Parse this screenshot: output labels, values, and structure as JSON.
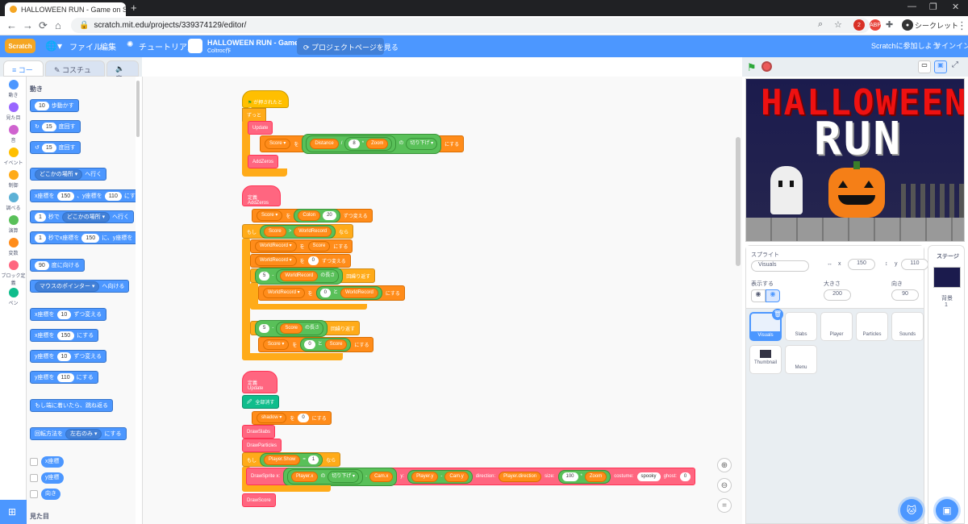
{
  "browser": {
    "tab_title": "HALLOWEEN RUN - Game on Sc",
    "url": "scratch.mit.edu/projects/339374129/editor/",
    "profile_label": "シークレット",
    "ext_badge": "2",
    "abp": "ABP"
  },
  "menu": {
    "logo": "Scratch",
    "file": "ファイル",
    "edit": "編集",
    "tutorials": "チュートリアル",
    "project_title": "HALLOWEEN RUN - Game",
    "author": "Coltroc作",
    "project_page": "プロジェクトページを見る",
    "join": "Scratchに参加しよう",
    "signin": "サインイン"
  },
  "tabs": {
    "code": "コード",
    "costumes": "コスチューム",
    "sounds": "音"
  },
  "categories": [
    {
      "label": "動き",
      "color": "#4c97ff"
    },
    {
      "label": "見た目",
      "color": "#9966ff"
    },
    {
      "label": "音",
      "color": "#cf63cf"
    },
    {
      "label": "イベント",
      "color": "#ffbf00"
    },
    {
      "label": "制御",
      "color": "#ffab19"
    },
    {
      "label": "調べる",
      "color": "#5cb1d6"
    },
    {
      "label": "演算",
      "color": "#59c059"
    },
    {
      "label": "変数",
      "color": "#ff8c1a"
    },
    {
      "label": "ブロック定義",
      "color": "#ff6680"
    },
    {
      "label": "ペン",
      "color": "#0fbd8c"
    }
  ],
  "palette": {
    "heading": "動き",
    "heading2": "見た目",
    "b1": {
      "num": "10",
      "text": "歩動かす"
    },
    "b2": {
      "num": "15",
      "text": "度回す"
    },
    "b3": {
      "num": "15",
      "text": "度回す"
    },
    "b4": {
      "dd": "どこかの場所 ▾",
      "text": "へ行く"
    },
    "b5": {
      "t1": "x座標を",
      "x": "150",
      "t2": "、y座標を",
      "y": "110",
      "t3": "にする"
    },
    "b6": {
      "n": "1",
      "t1": "秒で",
      "dd": "どこかの場所 ▾",
      "t2": "へ行く"
    },
    "b7": {
      "n": "1",
      "t1": "秒でx座標を",
      "x": "150",
      "t2": "に、y座標を"
    },
    "b8": {
      "n": "90",
      "text": "度に向ける"
    },
    "b9": {
      "dd": "マウスのポインター ▾",
      "text": "へ向ける"
    },
    "b10": {
      "t1": "x座標を",
      "n": "10",
      "t2": "ずつ変える"
    },
    "b11": {
      "t1": "x座標を",
      "n": "150",
      "t2": "にする"
    },
    "b12": {
      "t1": "y座標を",
      "n": "10",
      "t2": "ずつ変える"
    },
    "b13": {
      "t1": "y座標を",
      "n": "110",
      "t2": "にする"
    },
    "b14": "もし端に着いたら、跳ね返る",
    "b15": {
      "t1": "回転方法を",
      "dd": "左右のみ ▾",
      "t2": "にする"
    },
    "r1": "x座標",
    "r2": "y座標",
    "r3": "向き"
  },
  "script1": {
    "hat": "が押されたとき",
    "forever": "ずっと",
    "update": "Update",
    "set": "Score ▾",
    "wo": "を",
    "op1": "Distance",
    "slash": "/",
    "n8": "8",
    "star": "*",
    "zoom": "Zoom",
    "no": "の",
    "floor": "切り下げ ▾",
    "nisuru": "にする",
    "addzeros": "AddZeros"
  },
  "script2": {
    "define": "定義",
    "name": "AddZeros",
    "set": "Score ▾",
    "wo": "を",
    "join": "Colon",
    "n20": "20",
    "zutsu": "ずつ変える",
    "moshi": "もし",
    "score": "Score",
    "gt": ">",
    "wr": "WorldRecord",
    "nara": "なら",
    "wr_dd": "WorldRecord ▾",
    "niSuru": "にする",
    "n0": "0",
    "n5": "5",
    "minus": "-",
    "nagasa": "の長さ",
    "kaikurikaesu": "回繰り返す",
    "to": "と",
    "score_dd": "Score ▾"
  },
  "script3": {
    "define": "定義",
    "name": "Update",
    "erase": "全部消す",
    "shadow": "shadow ▾",
    "wo": "を",
    "n0": "0",
    "nisuru": "にする",
    "drawslabs": "DrawSlabs",
    "drawparticles": "DrawParticles",
    "moshi": "もし",
    "show": "Player.Show",
    "eq": "=",
    "n1": "1",
    "nara": "なら",
    "drawsprite": "DrawSprite x:",
    "px": "Player.x",
    "no": "の",
    "floor": "切り下げ ▾",
    "minus": "-",
    "camx": "Cam.x",
    "y": "y:",
    "py": "Player.y",
    "camy": "Cam.y",
    "dir": "direction:",
    "pdir": "Player.direction",
    "size": "size:",
    "n100": "100",
    "star": "*",
    "zoom": "Zoom",
    "costume": "costume:",
    "spooky": "spooky",
    "ghost": "ghost:",
    "g0": "0",
    "drawscore": "DrawScore"
  },
  "stage": {
    "title1": "HALLOWEEN",
    "title2": "RUN"
  },
  "sprite_info": {
    "label": "スプライト",
    "name": "Visuals",
    "x_label": "x",
    "x": "150",
    "y_label": "y",
    "y": "110",
    "show_label": "表示する",
    "size_label": "大きさ",
    "size": "200",
    "dir_label": "向き",
    "dir": "90"
  },
  "sprites": [
    "Visuals",
    "Slabs",
    "Player",
    "Particles",
    "Sounds",
    "Thumbnail",
    "Menu"
  ],
  "stage_col": {
    "label": "ステージ",
    "bg_label": "背景",
    "bg_count": "1"
  },
  "colors": {
    "scratch_blue": "#4c97ff",
    "control": "#ffab19",
    "operators": "#59c059",
    "variables": "#ff8c1a",
    "myblocks": "#ff6680",
    "events": "#ffbf00"
  }
}
